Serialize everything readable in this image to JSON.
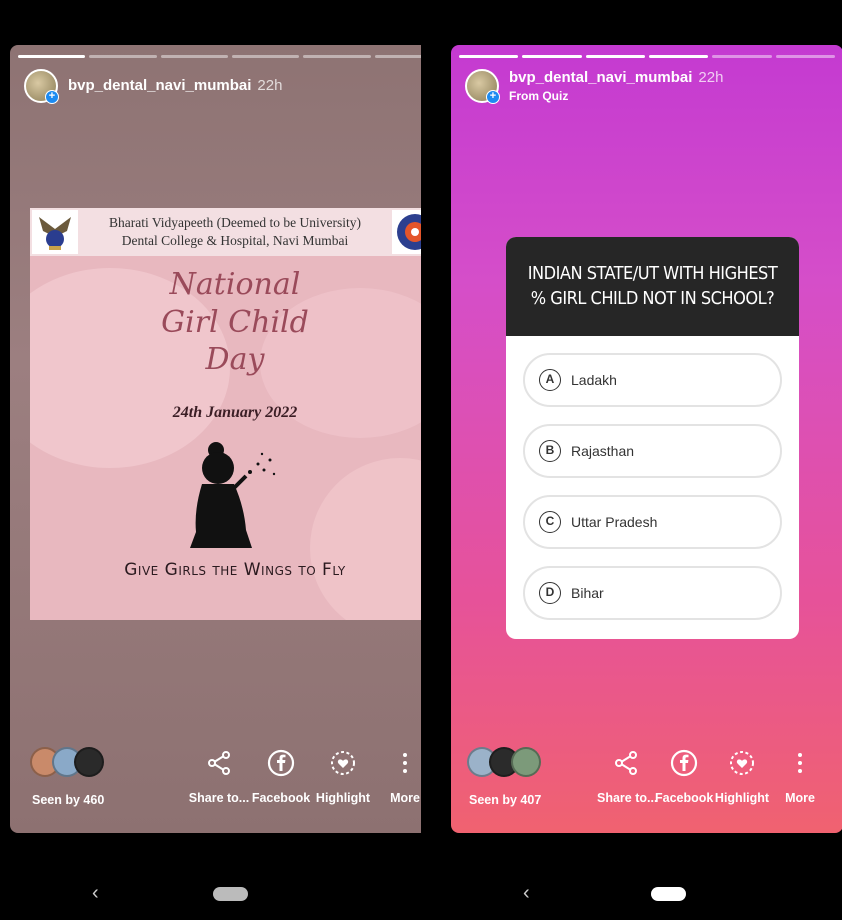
{
  "left": {
    "header": {
      "username": "bvp_dental_navi_mumbai",
      "time": "22h"
    },
    "poster": {
      "college_line1": "Bharati Vidyapeeth (Deemed to be University)",
      "college_line2": "Dental College & Hospital, Navi Mumbai",
      "title_line1": "National",
      "title_line2": "Girl Child",
      "title_line3": "Day",
      "date": "24th January  2022",
      "tagline": "Give Girls the Wings to Fly"
    },
    "footer": {
      "seen": "Seen by 460",
      "actions": [
        "Share to...",
        "Facebook",
        "Highlight",
        "More"
      ]
    }
  },
  "right": {
    "header": {
      "username": "bvp_dental_navi_mumbai",
      "time": "22h",
      "subtitle": "From Quiz"
    },
    "quiz": {
      "question": "INDIAN STATE/UT WITH HIGHEST % GIRL CHILD NOT IN SCHOOL?",
      "options": [
        {
          "letter": "A",
          "text": "Ladakh"
        },
        {
          "letter": "B",
          "text": "Rajasthan"
        },
        {
          "letter": "C",
          "text": "Uttar Pradesh"
        },
        {
          "letter": "D",
          "text": "Bihar"
        }
      ]
    },
    "footer": {
      "seen": "Seen by 407",
      "actions": [
        "Share to...",
        "Facebook",
        "Highlight",
        "More"
      ]
    }
  },
  "nav": {
    "back": "‹"
  },
  "colors": {
    "left_bg": "#8e7373",
    "right_bg_top": "#c43ad1",
    "right_bg_bottom": "#f06270",
    "badge": "#1d8bf1"
  }
}
